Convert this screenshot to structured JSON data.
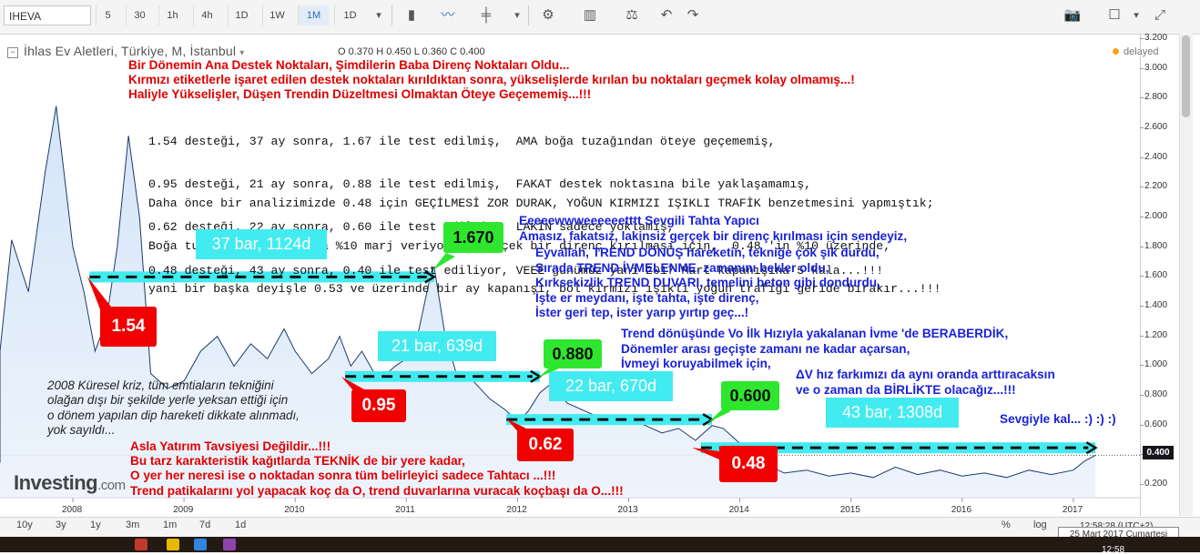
{
  "toolbar": {
    "symbol": "IHEVA",
    "timeframes": [
      "5",
      "30",
      "1h",
      "4h",
      "1D",
      "1W",
      "1M",
      "1D"
    ],
    "active_timeframe": "1M"
  },
  "legend": {
    "title": "İhlas Ev Aletleri, Türkiye, M, İstanbul",
    "ohlc": "O 0.370 H 0.450 L 0.360 C 0.400",
    "delayed": "delayed"
  },
  "axis": {
    "y_ticks": [
      "3.200",
      "3.000",
      "2.800",
      "2.600",
      "2.400",
      "2.200",
      "2.000",
      "1.800",
      "1.600",
      "1.400",
      "1.200",
      "1.000",
      "0.800",
      "0.600",
      "0.400",
      "0.200"
    ],
    "current_price": "0.400",
    "x_ticks": [
      "2008",
      "2009",
      "2010",
      "2011",
      "2012",
      "2013",
      "2014",
      "2015",
      "2016",
      "2017"
    ]
  },
  "footer": {
    "ranges": [
      "10y",
      "3y",
      "1y",
      "3m",
      "1m",
      "7d",
      "1d"
    ],
    "clock": "12:58:28 (UTC+2)",
    "percent": "%",
    "log": "log",
    "tooltip": "25 Mart 2017 Cumartesi",
    "logo_main": "Investing",
    "logo_suffix": ".com",
    "taskbar_time": "12:58"
  },
  "annotations": {
    "head_red": [
      "Bir Dönemin Ana Destek Noktaları, Şimdilerin Baba Direnç Noktaları Oldu...",
      "Kırmızı etiketlerle işaret edilen destek noktaları kırıldıktan sonra, yükselişlerde kırılan bu noktaları geçmek kolay olmamış...!",
      "Haliyle Yükselişler, Düşen Trendin Düzeltmesi Olmaktan Öteye Geçememiş...!!!"
    ],
    "mono_block1": [
      "1.54 desteği, 37 ay sonra, 1.67 ile test edilmiş,  AMA boğa tuzağından öteye geçememiş,",
      "0.95 desteği, 21 ay sonra, 0.88 ile test edilmiş,  FAKAT destek noktasına bile yaklaşamamış,",
      "0.62 desteği, 22 ay sonra, 0.60 ile test edilmiş,  LAKİN sadece yoklamış,",
      "0.48 desteği, 43 ay sonra, 0.40 ile test ediliyor, VEEE günümüz yani 2017 Mart kapanışına 5 kala...!!!"
    ],
    "mono_block2": [
      "Daha önce bir analizimizde 0.48 için GEÇİLMESİ ZOR DURAK, YOĞUN KIRMIZI IŞIKLI TRAFİK benzetmesini yapmıştık;",
      "Boğa tuzağı aldatmacasına %10 marj veriyorum. Gerçek bir direnç kırılması için,  0.48 'in %10 üzerinde,",
      "yani bir başka deyişle 0.53 ve üzerinde bir ay kapanışı, bol kırmızı ışıklı yoğun trafiği geride bırakır...!!!"
    ],
    "blue1": [
      "Eeeeewwweeeeeetttt Sevgili Tahta Yapıcı",
      "Amasız, fakatsız, lakinsiz gerçek bir direnç kırılması için sendeyiz,"
    ],
    "blue2": [
      "Eyvallah, TREND DÖNÜŞ hareketin, tekniğe çok şık durdu,",
      "Sırada TREND İVMELENME, zamanını bekler oldu,",
      "Kırksekizlik TREND DUVARI, temelini beton gibi dondurdu,",
      "İşte er meydanı, işte tahta, işte direnç,",
      "İster geri tep, ister yarıp yırtıp geç...!"
    ],
    "blue3": [
      "Trend dönüşünde Vo İlk Hızıyla yakalanan İvme 'de BERABERDİK,",
      "Dönemler arası geçişte zamanı ne kadar açarsan,",
      "İvmeyi koruyabilmek için,"
    ],
    "blue4": [
      "ΔV hız farkımızı da aynı oranda arttıracaksın",
      "ve o zaman da  BİRLİKTE olacağız...!!!"
    ],
    "blue5": "Sevgiyle kal... :) :) :)",
    "italic": [
      "2008 Küresel kriz, tüm emtiaların tekniğini",
      "olağan dışı bir şekilde yerle yeksan ettiği için",
      "o dönem yapılan dip hareketi dikkate alınmadı,",
      "yok sayıldı..."
    ],
    "bottom_red": [
      "Asla Yatırım Tavsiyesi Değildir...!!!",
      "Bu tarz karakteristik kağıtlarda TEKNİK de bir yere kadar,",
      "O yer her neresi ise o noktadan sonra tüm belirleyici sadece Tahtacı ...!!!",
      "Trend patikalarını yol yapacak koç da O, trend duvarlarına vuracak koçbaşı da O...!!!"
    ],
    "bars": [
      "37 bar, 1124d",
      "21 bar, 639d",
      "22 bar, 670d",
      "43 bar, 1308d"
    ],
    "supports": [
      "1.54",
      "0.95",
      "0.62",
      "0.48"
    ],
    "tests": [
      "1.670",
      "0.880",
      "0.600"
    ]
  },
  "chart_data": {
    "type": "area",
    "title": "İhlas Ev Aletleri, Türkiye, M, İstanbul",
    "xlabel": "",
    "ylabel": "",
    "ylim": [
      0.1,
      3.2
    ],
    "x": [
      2007.0,
      2007.15,
      2007.3,
      2007.45,
      2007.6,
      2007.75,
      2007.85,
      2008.0,
      2008.1,
      2008.2,
      2008.3,
      2008.4,
      2008.5,
      2008.6,
      2008.7,
      2008.85,
      2009.0,
      2009.15,
      2009.3,
      2009.45,
      2009.6,
      2009.75,
      2009.9,
      2010.0,
      2010.15,
      2010.3,
      2010.4,
      2010.5,
      2010.6,
      2010.75,
      2010.9,
      2011.0,
      2011.1,
      2011.2,
      2011.25,
      2011.35,
      2011.45,
      2011.6,
      2011.75,
      2011.9,
      2012.0,
      2012.1,
      2012.2,
      2012.3,
      2012.45,
      2012.6,
      2012.75,
      2012.9,
      2013.0,
      2013.15,
      2013.3,
      2013.45,
      2013.6,
      2013.75,
      2013.85,
      2014.0,
      2014.2,
      2014.4,
      2014.6,
      2014.8,
      2015.0,
      2015.2,
      2015.4,
      2015.6,
      2015.8,
      2016.0,
      2016.2,
      2016.4,
      2016.6,
      2016.8,
      2017.0,
      2017.1,
      2017.2
    ],
    "values": [
      0.35,
      0.5,
      1.1,
      1.85,
      1.5,
      2.3,
      2.75,
      1.8,
      1.5,
      1.1,
      1.3,
      1.8,
      2.55,
      2.0,
      0.95,
      0.85,
      0.9,
      1.1,
      1.2,
      1.0,
      1.15,
      1.05,
      1.25,
      1.1,
      0.95,
      1.05,
      1.2,
      1.0,
      1.1,
      0.9,
      1.0,
      1.05,
      1.2,
      1.55,
      1.67,
      1.2,
      0.95,
      0.9,
      0.78,
      0.7,
      0.62,
      0.7,
      0.82,
      0.88,
      0.75,
      0.7,
      0.65,
      0.62,
      0.65,
      0.6,
      0.55,
      0.58,
      0.5,
      0.6,
      0.58,
      0.48,
      0.35,
      0.28,
      0.3,
      0.26,
      0.28,
      0.25,
      0.32,
      0.27,
      0.3,
      0.26,
      0.28,
      0.25,
      0.3,
      0.27,
      0.3,
      0.36,
      0.4
    ],
    "support_lines": [
      {
        "label": "1.54",
        "value": 1.6,
        "x_start": 2008.15,
        "x_end": 2011.25
      },
      {
        "label": "0.95",
        "value": 0.93,
        "x_start": 2010.45,
        "x_end": 2012.2
      },
      {
        "label": "0.62",
        "value": 0.64,
        "x_start": 2011.9,
        "x_end": 2013.75
      },
      {
        "label": "0.48",
        "value": 0.45,
        "x_start": 2013.65,
        "x_end": 2017.2
      }
    ]
  }
}
